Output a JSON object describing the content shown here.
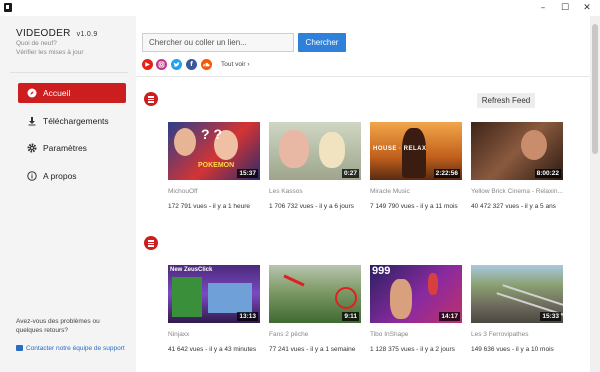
{
  "window": {
    "minimize": "–",
    "maximize": "☐",
    "close": "✕"
  },
  "sidebar": {
    "app_name": "VIDEODER",
    "version": "v1.0.9",
    "news_line1": "Quoi de neuf?",
    "news_line2": "Vérifier les mises à jour",
    "items": [
      {
        "label": "Accueil",
        "icon": "compass-icon",
        "active": true
      },
      {
        "label": "Téléchargements",
        "icon": "download-icon",
        "active": false
      },
      {
        "label": "Paramètres",
        "icon": "gear-icon",
        "active": false
      },
      {
        "label": "A propos",
        "icon": "info-icon",
        "active": false
      }
    ],
    "help_text": "Avez-vous des problèmes ou quelques retours?",
    "support_text": "Contacter notre équipe de support"
  },
  "search": {
    "placeholder": "Chercher ou coller un lien...",
    "button_label": "Chercher",
    "sites": [
      {
        "name": "youtube-icon",
        "color": "#e62117"
      },
      {
        "name": "instagram-icon",
        "color": "#c13584"
      },
      {
        "name": "twitter-icon",
        "color": "#1da1f2"
      },
      {
        "name": "facebook-icon",
        "color": "#3b5998"
      },
      {
        "name": "soundcloud-icon",
        "color": "#ff5500"
      }
    ],
    "see_all": "Tout voir ›"
  },
  "feed": {
    "refresh_label": "Refresh Feed",
    "rows": [
      {
        "videos": [
          {
            "title": "MichouOff",
            "views": "172 791 vues",
            "age": "il y a 1 heure",
            "duration": "15:37",
            "overlay": "POKEMON"
          },
          {
            "title": "Les Kassos",
            "views": "1 706 732 vues",
            "age": "il y a 6 jours",
            "duration": "0:27",
            "overlay": ""
          },
          {
            "title": "Miracle Music",
            "views": "7 149 790 vues",
            "age": "il y a 11 mois",
            "duration": "2:22:56",
            "overlay": "HOUSE · RELAX"
          },
          {
            "title": "Yellow Brick Cinema - Relaxin...",
            "views": "40 472 327 vues",
            "age": "il y a 5 ans",
            "duration": "8:00:22",
            "overlay": ""
          }
        ]
      },
      {
        "videos": [
          {
            "title": "Ninjaxx",
            "views": "41 642 vues",
            "age": "il y a 43 minutes",
            "duration": "13:13",
            "overlay": "New ZeusClick"
          },
          {
            "title": "Fans 2 pêche",
            "views": "77 241 vues",
            "age": "il y a 1 semaine",
            "duration": "9:11",
            "overlay": ""
          },
          {
            "title": "Tibo InShape",
            "views": "1 128 375 vues",
            "age": "il y a 2 jours",
            "duration": "14:17",
            "overlay": "999"
          },
          {
            "title": "Les 3 Ferrovipathes",
            "views": "149 636 vues",
            "age": "il y a 10 mois",
            "duration": "15:33",
            "overlay": ""
          }
        ]
      }
    ]
  }
}
